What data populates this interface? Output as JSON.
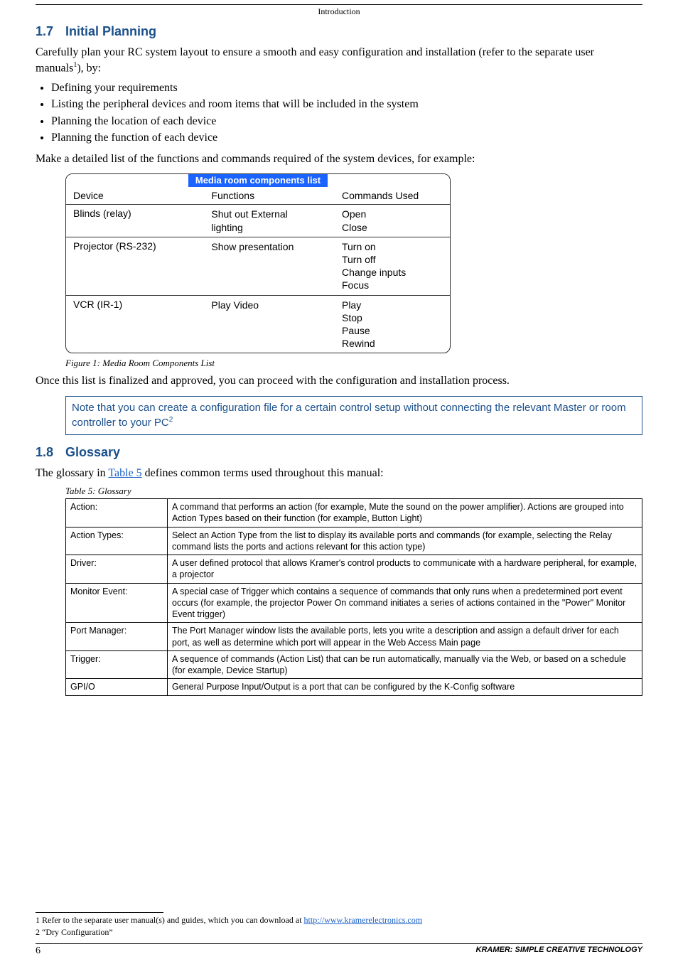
{
  "running_head": "Introduction",
  "section_1_7": {
    "num": "1.7",
    "title": "Initial Planning",
    "intro_a": "Carefully plan your RC system layout to ensure a smooth and easy configuration and installation (refer to the separate user manuals",
    "intro_sup": "1",
    "intro_b": "), by:",
    "bullets": [
      "Defining your requirements",
      "Listing the peripheral devices and room items that will be included in the system",
      "Planning the location of each device",
      "Planning the function of each device"
    ],
    "after_bullets": "Make a detailed list of the functions and commands required of the system devices, for example:"
  },
  "media_list": {
    "title": "Media room components list",
    "head": {
      "c1": "Device",
      "c2": "Functions",
      "c3": "Commands Used"
    },
    "rows": [
      {
        "device": "Blinds (relay)",
        "functions": [
          "Shut out External",
          "lighting"
        ],
        "commands": [
          "Open",
          "Close"
        ]
      },
      {
        "device": "Projector (RS-232)",
        "functions": [
          "Show presentation"
        ],
        "commands": [
          "Turn on",
          "Turn off",
          "Change inputs",
          "Focus"
        ]
      },
      {
        "device": "VCR (IR-1)",
        "functions": [
          "Play Video"
        ],
        "commands": [
          "Play",
          "Stop",
          "Pause",
          "Rewind"
        ]
      }
    ]
  },
  "figure1_caption": "Figure 1: Media Room Components List",
  "after_figure": "Once this list is finalized and approved, you can proceed with the configuration and installation process.",
  "note": {
    "text_a": "Note that you can create a configuration file for a certain control setup without connecting the relevant Master or room controller to your PC",
    "sup": "2"
  },
  "section_1_8": {
    "num": "1.8",
    "title": "Glossary",
    "intro_a": "The glossary in ",
    "link": "Table 5",
    "intro_b": " defines common terms used throughout this manual:"
  },
  "table5_caption": "Table 5: Glossary",
  "glossary": [
    {
      "term": "Action:",
      "def": "A command that performs an action (for example, Mute the sound on the power amplifier). Actions are grouped into Action Types based on their function (for example, Button Light)"
    },
    {
      "term": "Action Types:",
      "def": "Select an Action Type from the list to display its available ports and commands (for example, selecting the Relay command lists the ports and actions relevant for this action type)"
    },
    {
      "term": "Driver:",
      "def": "A user defined protocol that allows Kramer's control products to communicate with a hardware peripheral, for example, a projector"
    },
    {
      "term": "Monitor Event:",
      "def": "A special case of Trigger which contains a sequence of commands that only runs when a predetermined port event occurs (for example, the projector Power On command initiates a series of actions contained in the \"Power\" Monitor Event trigger)"
    },
    {
      "term": "Port Manager:",
      "def": "The Port Manager window lists the available ports, lets you write a description and assign a default driver for each port, as well as determine which port will appear in the Web Access Main page"
    },
    {
      "term": "Trigger:",
      "def": "A sequence of commands (Action List) that can be run automatically, manually via the Web, or based on a schedule (for example, Device Startup)"
    },
    {
      "term": "GPI/O",
      "def": "General Purpose Input/Output is a port that can be configured by the K-Config software"
    }
  ],
  "footnote1_a": "1 Refer to the separate user manual(s) and guides, which you can download at ",
  "footnote1_link": "http://www.kramerelectronics.com",
  "footnote2": "2 “Dry Configuration”",
  "footer": {
    "page": "6",
    "brand": "KRAMER:  SIMPLE CREATIVE TECHNOLOGY"
  }
}
